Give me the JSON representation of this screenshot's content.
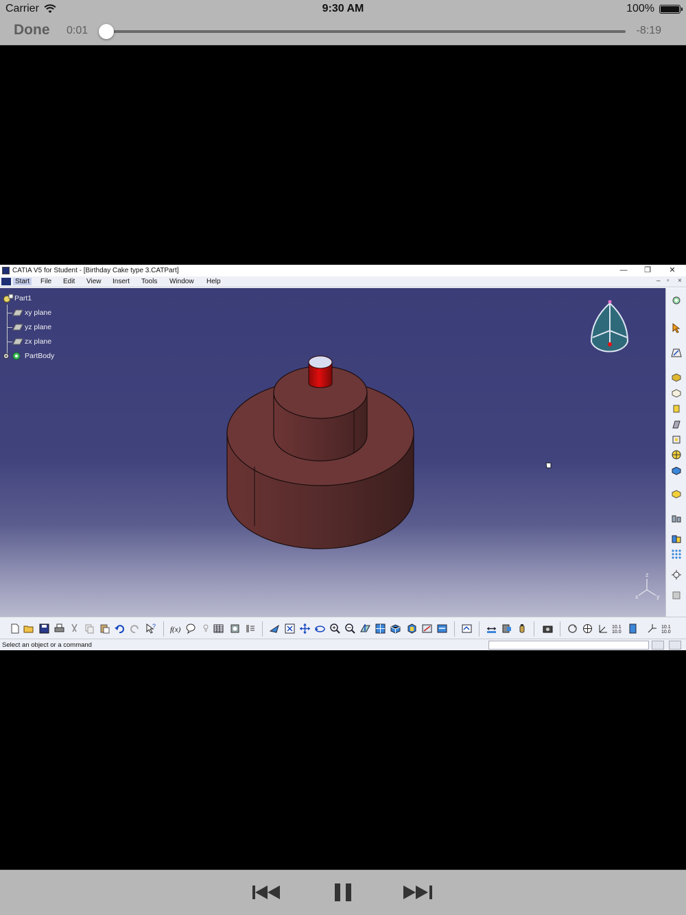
{
  "status_bar": {
    "carrier": "Carrier",
    "time": "9:30 AM",
    "battery": "100%"
  },
  "player": {
    "done_label": "Done",
    "elapsed": "0:01",
    "remaining": "-8:19",
    "progress": 0.002
  },
  "catia": {
    "window_title": "CATIA V5 for Student - [Birthday Cake type 3.CATPart]",
    "menu": [
      "Start",
      "File",
      "Edit",
      "View",
      "Insert",
      "Tools",
      "Window",
      "Help"
    ],
    "tree": {
      "root": "Part1",
      "items": [
        "xy plane",
        "yz plane",
        "zx plane"
      ],
      "body": "PartBody"
    },
    "status_text": "Select an object or a command",
    "compass_axes": [
      "z",
      "x",
      "y"
    ],
    "colors": {
      "cake": "#6c3535",
      "candle": "#c50a0a",
      "background_top": "#3b3d78",
      "background_bottom": "#b9bacf"
    }
  },
  "playback": {
    "previous": "previous-track",
    "pause": "pause",
    "next": "next-track"
  }
}
